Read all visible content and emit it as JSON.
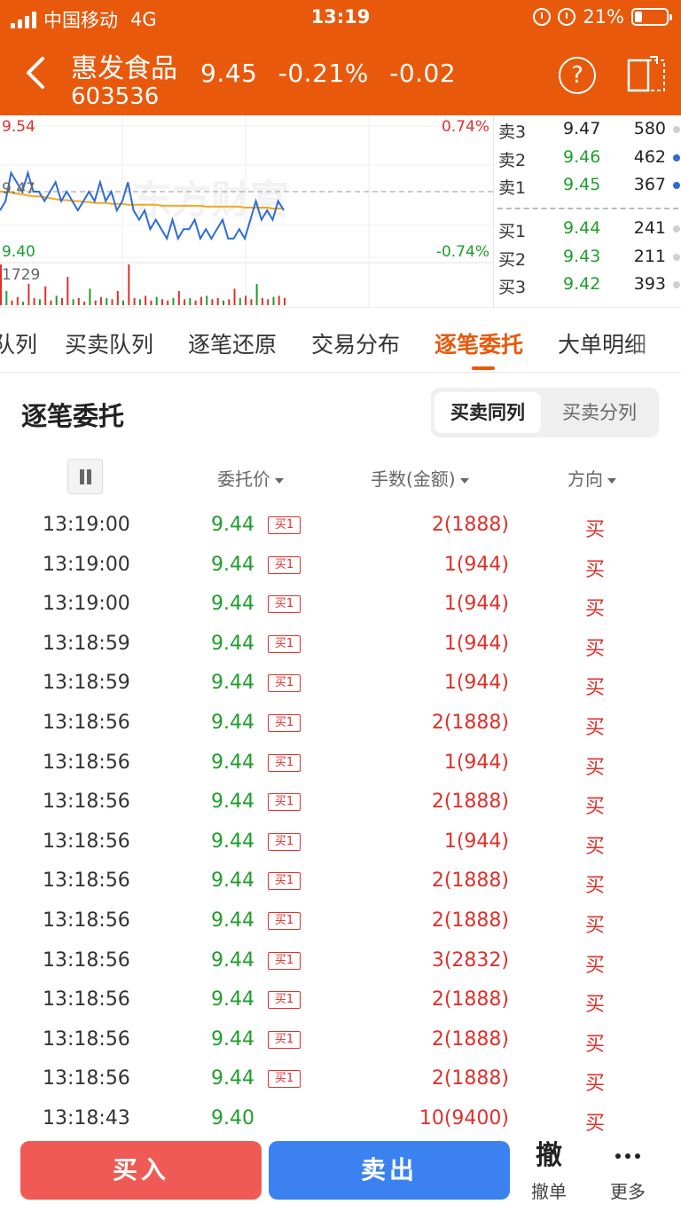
{
  "status_bar": {
    "carrier": "中国移动",
    "network": "4G",
    "time": "13:19",
    "battery": "21%"
  },
  "header": {
    "name": "惠发食品",
    "code": "603536",
    "price": "9.45",
    "change_pct": "-0.21%",
    "change": "-0.02",
    "help_label": "?"
  },
  "mini_chart": {
    "high_price": "9.54",
    "high_pct": "0.74%",
    "low_price": "9.40",
    "low_pct": "-0.74%",
    "ref_price": "9.47",
    "volume_max": "1729",
    "watermark": "东方财富",
    "price_points": [
      9.45,
      9.46,
      9.49,
      9.48,
      9.47,
      9.49,
      9.47,
      9.47,
      9.46,
      9.47,
      9.48,
      9.46,
      9.47,
      9.46,
      9.45,
      9.46,
      9.47,
      9.46,
      9.48,
      9.46,
      9.47,
      9.45,
      9.46,
      9.48,
      9.45,
      9.44,
      9.45,
      9.43,
      9.44,
      9.43,
      9.42,
      9.44,
      9.42,
      9.43,
      9.43,
      9.44,
      9.42,
      9.43,
      9.42,
      9.43,
      9.44,
      9.42,
      9.42,
      9.43,
      9.42,
      9.44,
      9.46,
      9.44,
      9.45,
      9.44,
      9.46,
      9.45
    ],
    "avg_points": [
      9.47,
      9.47,
      9.469,
      9.468,
      9.467,
      9.466,
      9.465,
      9.465,
      9.464,
      9.463,
      9.462,
      9.461,
      9.461,
      9.46,
      9.46,
      9.459,
      9.459,
      9.458,
      9.458,
      9.458,
      9.457,
      9.457,
      9.457,
      9.456,
      9.456,
      9.456,
      9.456,
      9.456,
      9.456,
      9.455,
      9.455,
      9.455,
      9.455,
      9.455,
      9.455,
      9.455,
      9.455,
      9.454,
      9.454,
      9.454,
      9.454,
      9.454,
      9.454,
      9.454,
      9.453,
      9.453,
      9.453,
      9.453,
      9.453,
      9.452,
      9.452,
      9.452
    ],
    "price_min": 9.4,
    "price_max": 9.54,
    "volumes": [
      1729,
      600,
      200,
      350,
      150,
      900,
      300,
      250,
      800,
      200,
      400,
      300,
      1200,
      250,
      300,
      150,
      700,
      200,
      350,
      300,
      250,
      600,
      200,
      1729,
      300,
      250,
      400,
      200,
      350,
      250,
      200,
      300,
      600,
      250,
      300,
      200,
      350,
      400,
      250,
      300,
      200,
      250,
      700,
      300,
      400,
      250,
      900,
      300,
      250,
      350,
      400,
      300
    ]
  },
  "order_book": {
    "asks": [
      {
        "label": "卖3",
        "price": "9.47",
        "volume": "580",
        "color": "#222222",
        "dot": "grey"
      },
      {
        "label": "卖2",
        "price": "9.46",
        "volume": "462",
        "color": "#1e9e2a",
        "dot": "blue"
      },
      {
        "label": "卖1",
        "price": "9.45",
        "volume": "367",
        "color": "#1e9e2a",
        "dot": "blue"
      }
    ],
    "bids": [
      {
        "label": "买1",
        "price": "9.44",
        "volume": "241",
        "color": "#1e9e2a",
        "dot": "grey"
      },
      {
        "label": "买2",
        "price": "9.43",
        "volume": "211",
        "color": "#1e9e2a",
        "dot": "grey"
      },
      {
        "label": "买3",
        "price": "9.42",
        "volume": "393",
        "color": "#1e9e2a",
        "dot": "grey"
      }
    ]
  },
  "tabs": [
    {
      "label": "队列",
      "active": false
    },
    {
      "label": "买卖队列",
      "active": false
    },
    {
      "label": "逐笔还原",
      "active": false
    },
    {
      "label": "交易分布",
      "active": false
    },
    {
      "label": "逐笔委托",
      "active": true
    },
    {
      "label": "大单明细",
      "active": false
    }
  ],
  "section": {
    "title": "逐笔委托",
    "seg_on": "买卖同列",
    "seg_off": "买卖分列"
  },
  "columns": {
    "price": "委托价",
    "volume": "手数(金额)",
    "direction": "方向"
  },
  "rows": [
    {
      "time": "13:19:00",
      "price": "9.44",
      "tag": "买1",
      "volume": "2(1888)",
      "dir": "买"
    },
    {
      "time": "13:19:00",
      "price": "9.44",
      "tag": "买1",
      "volume": "1(944)",
      "dir": "买"
    },
    {
      "time": "13:19:00",
      "price": "9.44",
      "tag": "买1",
      "volume": "1(944)",
      "dir": "买"
    },
    {
      "time": "13:18:59",
      "price": "9.44",
      "tag": "买1",
      "volume": "1(944)",
      "dir": "买"
    },
    {
      "time": "13:18:59",
      "price": "9.44",
      "tag": "买1",
      "volume": "1(944)",
      "dir": "买"
    },
    {
      "time": "13:18:56",
      "price": "9.44",
      "tag": "买1",
      "volume": "2(1888)",
      "dir": "买"
    },
    {
      "time": "13:18:56",
      "price": "9.44",
      "tag": "买1",
      "volume": "1(944)",
      "dir": "买"
    },
    {
      "time": "13:18:56",
      "price": "9.44",
      "tag": "买1",
      "volume": "2(1888)",
      "dir": "买"
    },
    {
      "time": "13:18:56",
      "price": "9.44",
      "tag": "买1",
      "volume": "1(944)",
      "dir": "买"
    },
    {
      "time": "13:18:56",
      "price": "9.44",
      "tag": "买1",
      "volume": "2(1888)",
      "dir": "买"
    },
    {
      "time": "13:18:56",
      "price": "9.44",
      "tag": "买1",
      "volume": "2(1888)",
      "dir": "买"
    },
    {
      "time": "13:18:56",
      "price": "9.44",
      "tag": "买1",
      "volume": "3(2832)",
      "dir": "买"
    },
    {
      "time": "13:18:56",
      "price": "9.44",
      "tag": "买1",
      "volume": "2(1888)",
      "dir": "买"
    },
    {
      "time": "13:18:56",
      "price": "9.44",
      "tag": "买1",
      "volume": "2(1888)",
      "dir": "买"
    },
    {
      "time": "13:18:56",
      "price": "9.44",
      "tag": "买1",
      "volume": "2(1888)",
      "dir": "买"
    },
    {
      "time": "13:18:43",
      "price": "9.40",
      "tag": "",
      "volume": "10(9400)",
      "dir": "买"
    }
  ],
  "bottom": {
    "buy": "买入",
    "sell": "卖出",
    "cancel_glyph": "撤",
    "cancel_label": "撤单",
    "more_label": "更多"
  },
  "colors": {
    "brand": "#e8590c",
    "up": "#e0302b",
    "down": "#1e9e2a",
    "buy_button": "#ef5a55",
    "sell_button": "#3b82f0"
  }
}
